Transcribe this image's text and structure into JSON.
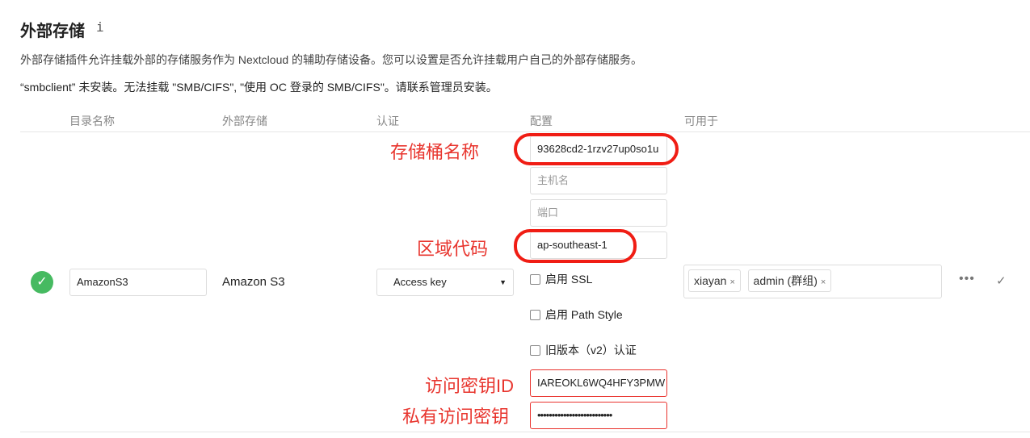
{
  "section": {
    "title": "外部存储",
    "info_icon": "i",
    "description": "外部存储插件允许挂载外部的存储服务作为 Nextcloud 的辅助存储设备。您可以设置是否允许挂载用户自己的外部存储服务。",
    "warning": "“smbclient” 未安装。无法挂载 \"SMB/CIFS\", \"使用 OC 登录的 SMB/CIFS\"。请联系管理员安装。"
  },
  "table": {
    "headers": [
      "目录名称",
      "外部存储",
      "认证",
      "配置",
      "可用于"
    ]
  },
  "row": {
    "status_color": "#46ba61",
    "folder_name": "AmazonS3",
    "backend": "Amazon S3",
    "auth": "Access key",
    "config": {
      "bucket": "93628cd2-1rzv27up0so1u",
      "hostname_placeholder": "主机名",
      "port_placeholder": "端口",
      "region": "ap-southeast-1",
      "enable_ssl": "启用 SSL",
      "path_style": "启用 Path Style",
      "legacy_auth": "旧版本（v2）认证",
      "access_key": "IAREOKL6WQ4HFY3PMW",
      "secret_key": "••••••••••••••••••••••••••"
    },
    "available_for": [
      {
        "label": "xiayan"
      },
      {
        "label": "admin (群组)"
      }
    ],
    "remove_icon": "×"
  },
  "annotations": {
    "bucket": "存储桶名称",
    "region": "区域代码",
    "access_key": "访问密钥ID",
    "secret_key": "私有访问密钥",
    "color": "#e8352e"
  }
}
